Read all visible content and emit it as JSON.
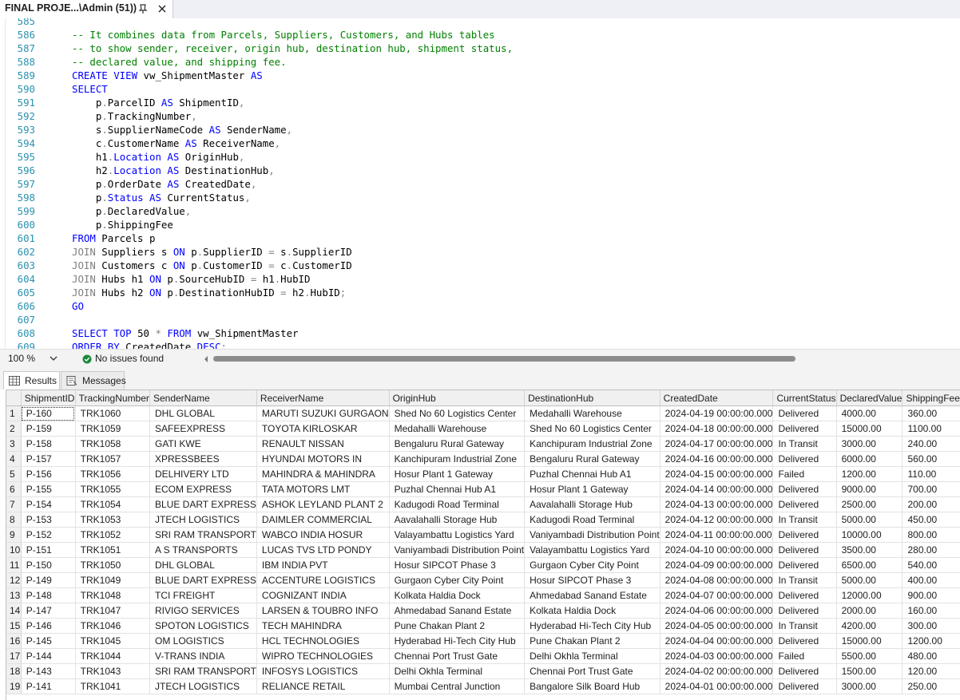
{
  "document_tab": {
    "title": "FINAL PROJE...\\Admin (51))",
    "pin_icon": "pin-icon",
    "close_icon": "close-icon"
  },
  "editor": {
    "lines": [
      {
        "n": "585",
        "tokens": []
      },
      {
        "n": "586",
        "tokens": [
          {
            "t": "c",
            "s": "-- It combines data from Parcels, Suppliers, Customers, and Hubs tables"
          }
        ]
      },
      {
        "n": "587",
        "tokens": [
          {
            "t": "c",
            "s": "-- to show sender, receiver, origin hub, destination hub, shipment status,"
          }
        ]
      },
      {
        "n": "588",
        "tokens": [
          {
            "t": "c",
            "s": "-- declared value, and shipping fee."
          }
        ]
      },
      {
        "n": "589",
        "tokens": [
          {
            "t": "k",
            "s": "CREATE VIEW"
          },
          {
            "t": "i",
            "s": " vw_ShipmentMaster "
          },
          {
            "t": "k",
            "s": "AS"
          }
        ]
      },
      {
        "n": "590",
        "tokens": [
          {
            "t": "k",
            "s": "SELECT"
          }
        ]
      },
      {
        "n": "591",
        "tokens": [
          {
            "t": "i",
            "s": "    p"
          },
          {
            "t": "g",
            "s": "."
          },
          {
            "t": "i",
            "s": "ParcelID "
          },
          {
            "t": "k",
            "s": "AS"
          },
          {
            "t": "i",
            "s": " ShipmentID"
          },
          {
            "t": "g",
            "s": ","
          }
        ]
      },
      {
        "n": "592",
        "tokens": [
          {
            "t": "i",
            "s": "    p"
          },
          {
            "t": "g",
            "s": "."
          },
          {
            "t": "i",
            "s": "TrackingNumber"
          },
          {
            "t": "g",
            "s": ","
          }
        ]
      },
      {
        "n": "593",
        "tokens": [
          {
            "t": "i",
            "s": "    s"
          },
          {
            "t": "g",
            "s": "."
          },
          {
            "t": "i",
            "s": "SupplierNameCode "
          },
          {
            "t": "k",
            "s": "AS"
          },
          {
            "t": "i",
            "s": " SenderName"
          },
          {
            "t": "g",
            "s": ","
          }
        ]
      },
      {
        "n": "594",
        "tokens": [
          {
            "t": "i",
            "s": "    c"
          },
          {
            "t": "g",
            "s": "."
          },
          {
            "t": "i",
            "s": "CustomerName "
          },
          {
            "t": "k",
            "s": "AS"
          },
          {
            "t": "i",
            "s": " ReceiverName"
          },
          {
            "t": "g",
            "s": ","
          }
        ]
      },
      {
        "n": "595",
        "tokens": [
          {
            "t": "i",
            "s": "    h1"
          },
          {
            "t": "g",
            "s": "."
          },
          {
            "t": "k",
            "s": "Location"
          },
          {
            "t": "i",
            "s": " "
          },
          {
            "t": "k",
            "s": "AS"
          },
          {
            "t": "i",
            "s": " OriginHub"
          },
          {
            "t": "g",
            "s": ","
          }
        ]
      },
      {
        "n": "596",
        "tokens": [
          {
            "t": "i",
            "s": "    h2"
          },
          {
            "t": "g",
            "s": "."
          },
          {
            "t": "k",
            "s": "Location"
          },
          {
            "t": "i",
            "s": " "
          },
          {
            "t": "k",
            "s": "AS"
          },
          {
            "t": "i",
            "s": " DestinationHub"
          },
          {
            "t": "g",
            "s": ","
          }
        ]
      },
      {
        "n": "597",
        "tokens": [
          {
            "t": "i",
            "s": "    p"
          },
          {
            "t": "g",
            "s": "."
          },
          {
            "t": "i",
            "s": "OrderDate "
          },
          {
            "t": "k",
            "s": "AS"
          },
          {
            "t": "i",
            "s": " CreatedDate"
          },
          {
            "t": "g",
            "s": ","
          }
        ]
      },
      {
        "n": "598",
        "tokens": [
          {
            "t": "i",
            "s": "    p"
          },
          {
            "t": "g",
            "s": "."
          },
          {
            "t": "k",
            "s": "Status"
          },
          {
            "t": "i",
            "s": " "
          },
          {
            "t": "k",
            "s": "AS"
          },
          {
            "t": "i",
            "s": " CurrentStatus"
          },
          {
            "t": "g",
            "s": ","
          }
        ]
      },
      {
        "n": "599",
        "tokens": [
          {
            "t": "i",
            "s": "    p"
          },
          {
            "t": "g",
            "s": "."
          },
          {
            "t": "i",
            "s": "DeclaredValue"
          },
          {
            "t": "g",
            "s": ","
          }
        ]
      },
      {
        "n": "600",
        "tokens": [
          {
            "t": "i",
            "s": "    p"
          },
          {
            "t": "g",
            "s": "."
          },
          {
            "t": "i",
            "s": "ShippingFee"
          }
        ]
      },
      {
        "n": "601",
        "tokens": [
          {
            "t": "k",
            "s": "FROM"
          },
          {
            "t": "i",
            "s": " Parcels p"
          }
        ]
      },
      {
        "n": "602",
        "tokens": [
          {
            "t": "g",
            "s": "JOIN"
          },
          {
            "t": "i",
            "s": " Suppliers s "
          },
          {
            "t": "k",
            "s": "ON"
          },
          {
            "t": "i",
            "s": " p"
          },
          {
            "t": "g",
            "s": "."
          },
          {
            "t": "i",
            "s": "SupplierID "
          },
          {
            "t": "g",
            "s": "="
          },
          {
            "t": "i",
            "s": " s"
          },
          {
            "t": "g",
            "s": "."
          },
          {
            "t": "i",
            "s": "SupplierID"
          }
        ]
      },
      {
        "n": "603",
        "tokens": [
          {
            "t": "g",
            "s": "JOIN"
          },
          {
            "t": "i",
            "s": " Customers c "
          },
          {
            "t": "k",
            "s": "ON"
          },
          {
            "t": "i",
            "s": " p"
          },
          {
            "t": "g",
            "s": "."
          },
          {
            "t": "i",
            "s": "CustomerID "
          },
          {
            "t": "g",
            "s": "="
          },
          {
            "t": "i",
            "s": " c"
          },
          {
            "t": "g",
            "s": "."
          },
          {
            "t": "i",
            "s": "CustomerID"
          }
        ]
      },
      {
        "n": "604",
        "tokens": [
          {
            "t": "g",
            "s": "JOIN"
          },
          {
            "t": "i",
            "s": " Hubs h1 "
          },
          {
            "t": "k",
            "s": "ON"
          },
          {
            "t": "i",
            "s": " p"
          },
          {
            "t": "g",
            "s": "."
          },
          {
            "t": "i",
            "s": "SourceHubID "
          },
          {
            "t": "g",
            "s": "="
          },
          {
            "t": "i",
            "s": " h1"
          },
          {
            "t": "g",
            "s": "."
          },
          {
            "t": "i",
            "s": "HubID"
          }
        ]
      },
      {
        "n": "605",
        "tokens": [
          {
            "t": "g",
            "s": "JOIN"
          },
          {
            "t": "i",
            "s": " Hubs h2 "
          },
          {
            "t": "k",
            "s": "ON"
          },
          {
            "t": "i",
            "s": " p"
          },
          {
            "t": "g",
            "s": "."
          },
          {
            "t": "i",
            "s": "DestinationHubID "
          },
          {
            "t": "g",
            "s": "="
          },
          {
            "t": "i",
            "s": " h2"
          },
          {
            "t": "g",
            "s": "."
          },
          {
            "t": "i",
            "s": "HubID"
          },
          {
            "t": "g",
            "s": ";"
          }
        ]
      },
      {
        "n": "606",
        "tokens": [
          {
            "t": "k",
            "s": "GO"
          }
        ]
      },
      {
        "n": "607",
        "tokens": []
      },
      {
        "n": "608",
        "tokens": [
          {
            "t": "k",
            "s": "SELECT TOP"
          },
          {
            "t": "i",
            "s": " 50 "
          },
          {
            "t": "g",
            "s": "*"
          },
          {
            "t": "i",
            "s": " "
          },
          {
            "t": "k",
            "s": "FROM"
          },
          {
            "t": "i",
            "s": " vw_ShipmentMaster"
          }
        ]
      },
      {
        "n": "609",
        "tokens": [
          {
            "t": "k",
            "s": "ORDER BY"
          },
          {
            "t": "i",
            "s": " CreatedDate "
          },
          {
            "t": "k",
            "s": "DESC"
          },
          {
            "t": "g",
            "s": ";"
          }
        ]
      }
    ],
    "colors": {
      "keyword": "#0000ff",
      "comment": "#008000",
      "operator": "#808080",
      "line_number": "#2b91af"
    }
  },
  "status_bar": {
    "zoom": "100 %",
    "issues": "No issues found",
    "zoom_icon": "chevron-down-icon",
    "issues_icon": "check-circle-icon"
  },
  "results_tabs": {
    "results_label": "Results",
    "messages_label": "Messages"
  },
  "grid": {
    "columns": [
      "ShipmentID",
      "TrackingNumber",
      "SenderName",
      "ReceiverName",
      "OriginHub",
      "DestinationHub",
      "CreatedDate",
      "CurrentStatus",
      "DeclaredValue",
      "ShippingFee"
    ],
    "rows": [
      [
        "1",
        "P-160",
        "TRK1060",
        "DHL GLOBAL",
        "MARUTI SUZUKI GURGAON",
        "Shed No 60 Logistics Center",
        "Medahalli Warehouse",
        "2024-04-19 00:00:00.000",
        "Delivered",
        "4000.00",
        "360.00"
      ],
      [
        "2",
        "P-159",
        "TRK1059",
        "SAFEEXPRESS",
        "TOYOTA KIRLOSKAR",
        "Medahalli Warehouse",
        "Shed No 60 Logistics Center",
        "2024-04-18 00:00:00.000",
        "Delivered",
        "15000.00",
        "1100.00"
      ],
      [
        "3",
        "P-158",
        "TRK1058",
        "GATI KWE",
        "RENAULT NISSAN",
        "Bengaluru Rural Gateway",
        "Kanchipuram Industrial Zone",
        "2024-04-17 00:00:00.000",
        "In Transit",
        "3000.00",
        "240.00"
      ],
      [
        "4",
        "P-157",
        "TRK1057",
        "XPRESSBEES",
        "HYUNDAI MOTORS IN",
        "Kanchipuram Industrial Zone",
        "Bengaluru Rural Gateway",
        "2024-04-16 00:00:00.000",
        "Delivered",
        "6000.00",
        "560.00"
      ],
      [
        "5",
        "P-156",
        "TRK1056",
        "DELHIVERY LTD",
        "MAHINDRA & MAHINDRA",
        "Hosur Plant 1 Gateway",
        "Puzhal Chennai Hub A1",
        "2024-04-15 00:00:00.000",
        "Failed",
        "1200.00",
        "110.00"
      ],
      [
        "6",
        "P-155",
        "TRK1055",
        "ECOM EXPRESS",
        "TATA MOTORS LMT",
        "Puzhal Chennai Hub A1",
        "Hosur Plant 1 Gateway",
        "2024-04-14 00:00:00.000",
        "Delivered",
        "9000.00",
        "700.00"
      ],
      [
        "7",
        "P-154",
        "TRK1054",
        "BLUE DART EXPRESS",
        "ASHOK LEYLAND PLANT 2",
        "Kadugodi Road Terminal",
        "Aavalahalli Storage Hub",
        "2024-04-13 00:00:00.000",
        "Delivered",
        "2500.00",
        "200.00"
      ],
      [
        "8",
        "P-153",
        "TRK1053",
        "JTECH LOGISTICS",
        "DAIMLER COMMERCIAL",
        "Aavalahalli Storage Hub",
        "Kadugodi Road Terminal",
        "2024-04-12 00:00:00.000",
        "In Transit",
        "5000.00",
        "450.00"
      ],
      [
        "9",
        "P-152",
        "TRK1052",
        "SRI RAM TRANSPORT",
        "WABCO INDIA HOSUR",
        "Valayambattu Logistics Yard",
        "Vaniyambadi Distribution Point",
        "2024-04-11 00:00:00.000",
        "Delivered",
        "10000.00",
        "800.00"
      ],
      [
        "10",
        "P-151",
        "TRK1051",
        "A S TRANSPORTS",
        "LUCAS TVS LTD PONDY",
        "Vaniyambadi Distribution Point",
        "Valayambattu Logistics Yard",
        "2024-04-10 00:00:00.000",
        "Delivered",
        "3500.00",
        "280.00"
      ],
      [
        "11",
        "P-150",
        "TRK1050",
        "DHL GLOBAL",
        "IBM INDIA PVT",
        "Hosur SIPCOT Phase 3",
        "Gurgaon Cyber City Point",
        "2024-04-09 00:00:00.000",
        "Delivered",
        "6500.00",
        "540.00"
      ],
      [
        "12",
        "P-149",
        "TRK1049",
        "BLUE DART EXPRESS",
        "ACCENTURE LOGISTICS",
        "Gurgaon Cyber City Point",
        "Hosur SIPCOT Phase 3",
        "2024-04-08 00:00:00.000",
        "In Transit",
        "5000.00",
        "400.00"
      ],
      [
        "13",
        "P-148",
        "TRK1048",
        "TCI FREIGHT",
        "COGNIZANT INDIA",
        "Kolkata Haldia Dock",
        "Ahmedabad Sanand Estate",
        "2024-04-07 00:00:00.000",
        "Delivered",
        "12000.00",
        "900.00"
      ],
      [
        "14",
        "P-147",
        "TRK1047",
        "RIVIGO SERVICES",
        "LARSEN & TOUBRO INFO",
        "Ahmedabad Sanand Estate",
        "Kolkata Haldia Dock",
        "2024-04-06 00:00:00.000",
        "Delivered",
        "2000.00",
        "160.00"
      ],
      [
        "15",
        "P-146",
        "TRK1046",
        "SPOTON LOGISTICS",
        "TECH MAHINDRA",
        "Pune Chakan Plant 2",
        "Hyderabad Hi-Tech City Hub",
        "2024-04-05 00:00:00.000",
        "In Transit",
        "4200.00",
        "300.00"
      ],
      [
        "16",
        "P-145",
        "TRK1045",
        "OM LOGISTICS",
        "HCL TECHNOLOGIES",
        "Hyderabad Hi-Tech City Hub",
        "Pune Chakan Plant 2",
        "2024-04-04 00:00:00.000",
        "Delivered",
        "15000.00",
        "1200.00"
      ],
      [
        "17",
        "P-144",
        "TRK1044",
        "V-TRANS INDIA",
        "WIPRO TECHNOLOGIES",
        "Chennai Port Trust Gate",
        "Delhi Okhla Terminal",
        "2024-04-03 00:00:00.000",
        "Failed",
        "5500.00",
        "480.00"
      ],
      [
        "18",
        "P-143",
        "TRK1043",
        "SRI RAM TRANSPORT",
        "INFOSYS LOGISTICS",
        "Delhi Okhla Terminal",
        "Chennai Port Trust Gate",
        "2024-04-02 00:00:00.000",
        "Delivered",
        "1500.00",
        "120.00"
      ],
      [
        "19",
        "P-141",
        "TRK1041",
        "JTECH LOGISTICS",
        "RELIANCE RETAIL",
        "Mumbai Central Junction",
        "Bangalore Silk Board Hub",
        "2024-04-01 00:00:00.000",
        "Delivered",
        "3000.00",
        "250.00"
      ]
    ]
  }
}
